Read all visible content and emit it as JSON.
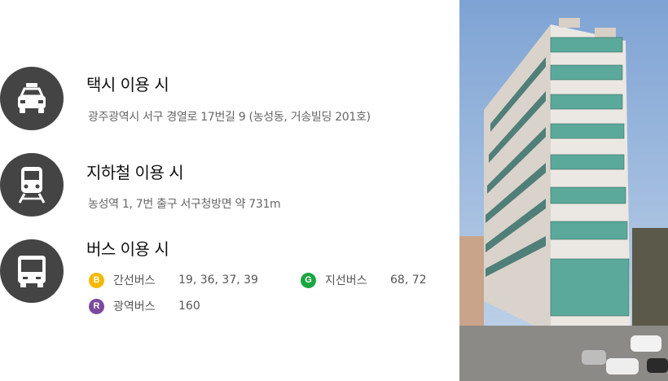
{
  "taxi": {
    "icon": "taxi-icon",
    "title": "택시 이용 시",
    "address": "광주광역시 서구 경열로 17번길 9 (농성동, 거송빌딩 201호)"
  },
  "subway": {
    "icon": "subway-icon",
    "title": "지하철 이용 시",
    "directions": "농성역 1, 7번 출구 서구청방면 약 731m"
  },
  "bus": {
    "icon": "bus-icon",
    "title": "버스 이용 시",
    "routes": [
      {
        "badge": "B",
        "badge_color": "#f5b800",
        "type": "간선버스",
        "numbers": "19, 36, 37, 39"
      },
      {
        "badge": "G",
        "badge_color": "#1aa641",
        "type": "지선버스",
        "numbers": "68, 72"
      },
      {
        "badge": "R",
        "badge_color": "#7b4a9c",
        "type": "광역버스",
        "numbers": "160"
      }
    ]
  },
  "colors": {
    "icon_circle": "#444444",
    "sky": "#8fb0d8",
    "building": "#e4e0da",
    "glass": "#5fa89a"
  }
}
